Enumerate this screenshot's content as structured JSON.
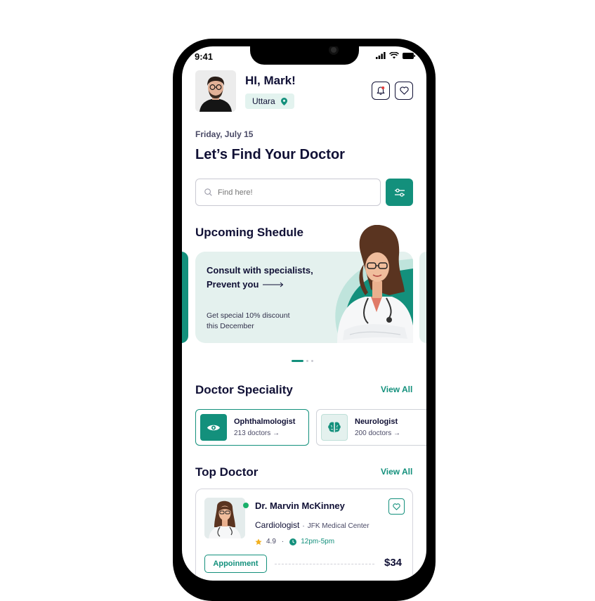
{
  "status_bar": {
    "time": "9:41"
  },
  "user": {
    "greeting": "HI, Mark!",
    "location": "Uttara"
  },
  "date": "Friday, July 15",
  "headline": "Let’s Find Your Doctor",
  "search": {
    "placeholder": "Find here!"
  },
  "upcoming": {
    "title": "Upcoming Shedule",
    "banner": {
      "line1": "Consult with specialists,",
      "line2": "Prevent you",
      "offer_line1": "Get special 10% discount",
      "offer_line2": "this December"
    },
    "carousel": {
      "active_index": 0,
      "total": 3
    }
  },
  "speciality": {
    "title": "Doctor Speciality",
    "view_all": "View All",
    "items": [
      {
        "name": "Ophthalmologist",
        "count": "213 doctors →",
        "icon": "eye-icon",
        "selected": true
      },
      {
        "name": "Neurologist",
        "count": "200 doctors →",
        "icon": "brain-icon",
        "selected": false
      }
    ]
  },
  "top_doctor": {
    "title": "Top Doctor",
    "view_all": "View All",
    "card": {
      "name": "Dr. Marvin McKinney",
      "specialty": "Cardiologist",
      "separator": "·",
      "hospital": "JFK Medical Center",
      "rating": "4.9",
      "meta_separator": "·",
      "hours": "12pm-5pm",
      "button": "Appoinment",
      "price": "$34",
      "online": true
    }
  },
  "colors": {
    "accent": "#13907c",
    "accent_light": "#e4f1ee",
    "text": "#101035",
    "online": "#19b06a",
    "star": "#f2b01e",
    "notification": "#e33b3b"
  }
}
